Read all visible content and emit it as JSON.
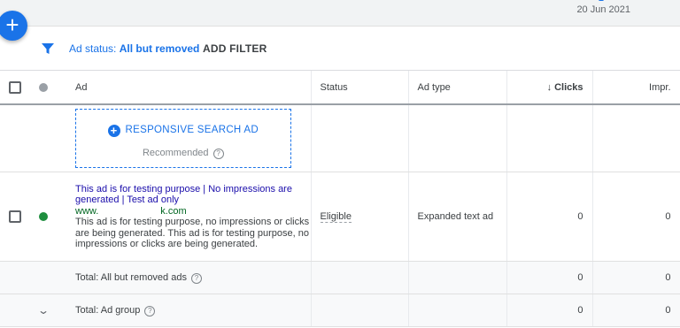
{
  "topbar": {
    "date": "20 Jun 2021"
  },
  "fab": {
    "label": "+"
  },
  "filter": {
    "prefix": "Ad status: ",
    "value": "All but removed",
    "add_label": "ADD FILTER"
  },
  "columns": {
    "ad": "Ad",
    "status": "Status",
    "ad_type": "Ad type",
    "clicks": "Clicks",
    "impr": "Impr."
  },
  "rsa": {
    "label": "RESPONSIVE SEARCH AD",
    "recommended": "Recommended"
  },
  "ad_row": {
    "headline": "This ad is for testing purpose | No impressions are generated | Test ad only",
    "url_start": "www.",
    "url_end": "k.com",
    "description": "This ad is for testing purpose, no impressions or clicks are being generated. This ad is for testing purpose, no impressions or clicks are being generated.",
    "status": "Eligible",
    "ad_type": "Expanded text ad",
    "clicks": "0",
    "impr": "0"
  },
  "totals": [
    {
      "label": "Total: All but removed ads",
      "clicks": "0",
      "impr": "0"
    },
    {
      "label": "Total: Ad group",
      "clicks": "0",
      "impr": "0"
    }
  ],
  "colors": {
    "accent": "#1a73e8",
    "headline": "#1a0dab",
    "url": "#006621",
    "status_green": "#1e8e3e"
  },
  "icons": [
    "plus-icon",
    "filter-icon",
    "checkbox-icon",
    "status-dot-icon",
    "add-circle-icon",
    "help-icon",
    "sort-down-arrow-icon",
    "chevron-down-icon"
  ]
}
